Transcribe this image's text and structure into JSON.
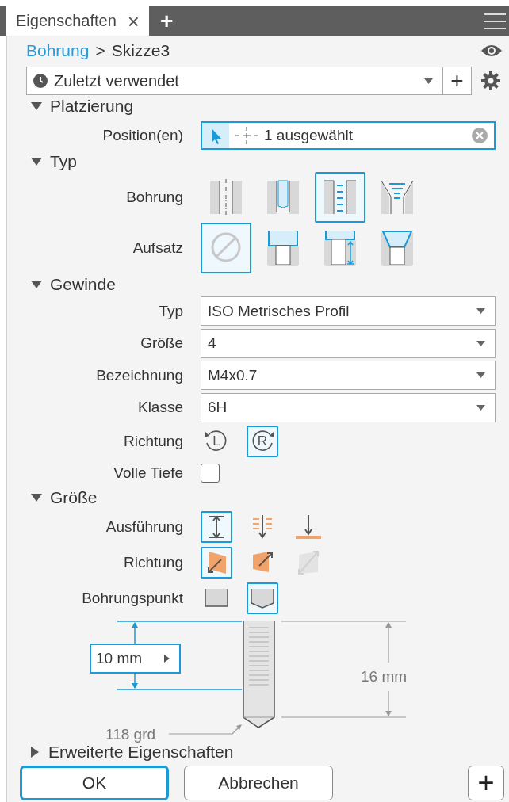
{
  "tab": {
    "title": "Eigenschaften",
    "close": "×",
    "add": "+"
  },
  "breadcrumb": {
    "parent": "Bohrung",
    "separator": ">",
    "current": "Skizze3"
  },
  "preset": {
    "value": "Zuletzt verwendet",
    "add": "+"
  },
  "sections": [
    {
      "title": "Platzierung",
      "expanded": true,
      "rows": [
        {
          "kind": "selection",
          "label": "Position(en)",
          "value": "1 ausgewählt"
        }
      ]
    },
    {
      "title": "Typ",
      "expanded": true,
      "rows": [
        {
          "kind": "tiles",
          "label": "Bohrung",
          "options": [
            {
              "selected": false
            },
            {
              "selected": false
            },
            {
              "selected": true
            },
            {
              "selected": false
            }
          ]
        },
        {
          "kind": "tiles",
          "label": "Aufsatz",
          "options": [
            {
              "selected": true
            },
            {
              "selected": false
            },
            {
              "selected": false
            },
            {
              "selected": false
            }
          ]
        }
      ]
    },
    {
      "title": "Gewinde",
      "expanded": true,
      "rows": [
        {
          "kind": "dropdown",
          "label": "Typ",
          "value": "ISO Metrisches Profil"
        },
        {
          "kind": "dropdown",
          "label": "Größe",
          "value": "4"
        },
        {
          "kind": "dropdown",
          "label": "Bezeichnung",
          "value": "M4x0.7"
        },
        {
          "kind": "dropdown",
          "label": "Klasse",
          "value": "6H"
        },
        {
          "kind": "icons",
          "label": "Richtung",
          "options": [
            {
              "glyph": "L",
              "selected": false
            },
            {
              "glyph": "R",
              "selected": true
            }
          ]
        },
        {
          "kind": "checkbox",
          "label": "Volle Tiefe",
          "checked": false
        }
      ]
    },
    {
      "title": "Größe",
      "expanded": true,
      "rows": [
        {
          "kind": "icons",
          "label": "Ausführung",
          "options": [
            {
              "selected": true
            },
            {
              "selected": false
            },
            {
              "selected": false
            }
          ]
        },
        {
          "kind": "icons",
          "label": "Richtung",
          "options": [
            {
              "selected": true,
              "disabled": false
            },
            {
              "selected": false,
              "disabled": false
            },
            {
              "selected": false,
              "disabled": true
            }
          ]
        },
        {
          "kind": "icons",
          "label": "Bohrungspunkt",
          "options": [
            {
              "selected": false
            },
            {
              "selected": true
            }
          ]
        }
      ]
    }
  ],
  "diagram": {
    "depth": "10 mm",
    "total": "16 mm",
    "angle": "118 grd"
  },
  "advanced": {
    "title": "Erweiterte Eigenschaften",
    "expanded": false
  },
  "buttons": [
    {
      "label": "OK",
      "default": true
    },
    {
      "label": "Abbrechen",
      "default": false
    }
  ],
  "add_button": "+"
}
